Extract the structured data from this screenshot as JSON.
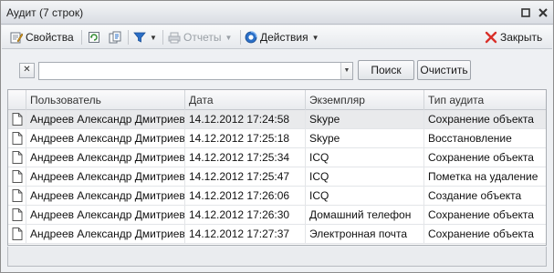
{
  "window": {
    "title": "Аудит (7 строк)"
  },
  "titlebar_buttons": [
    {
      "icon": "restore-icon"
    },
    {
      "icon": "close-icon"
    }
  ],
  "toolbar": {
    "properties_label": "Свойства",
    "reports_label": "Отчеты",
    "actions_label": "Действия",
    "close_label": "Закрыть"
  },
  "search": {
    "value": "",
    "placeholder": "",
    "search_label": "Поиск",
    "clear_label": "Очистить"
  },
  "grid": {
    "columns": [
      "Пользователь",
      "Дата",
      "Экземпляр",
      "Тип аудита"
    ],
    "rows": [
      {
        "user": "Андреев Александр Дмитриевич",
        "date": "14.12.2012 17:24:58",
        "instance": "Skype",
        "type": "Сохранение объекта"
      },
      {
        "user": "Андреев Александр Дмитриевич",
        "date": "14.12.2012 17:25:18",
        "instance": "Skype",
        "type": "Восстановление"
      },
      {
        "user": "Андреев Александр Дмитриевич",
        "date": "14.12.2012 17:25:34",
        "instance": "ICQ",
        "type": "Сохранение объекта"
      },
      {
        "user": "Андреев Александр Дмитриевич",
        "date": "14.12.2012 17:25:47",
        "instance": "ICQ",
        "type": "Пометка на удаление"
      },
      {
        "user": "Андреев Александр Дмитриевич",
        "date": "14.12.2012 17:26:06",
        "instance": "ICQ",
        "type": "Создание объекта"
      },
      {
        "user": "Андреев Александр Дмитриевич",
        "date": "14.12.2012 17:26:30",
        "instance": "Домашний телефон",
        "type": "Сохранение объекта"
      },
      {
        "user": "Андреев Александр Дмитриевич",
        "date": "14.12.2012 17:27:37",
        "instance": "Электронная почта",
        "type": "Сохранение объекта"
      }
    ]
  },
  "colors": {
    "selected_row": "#e9eaec",
    "close_red": "#d9302a",
    "accent_blue": "#2b6fc7"
  }
}
